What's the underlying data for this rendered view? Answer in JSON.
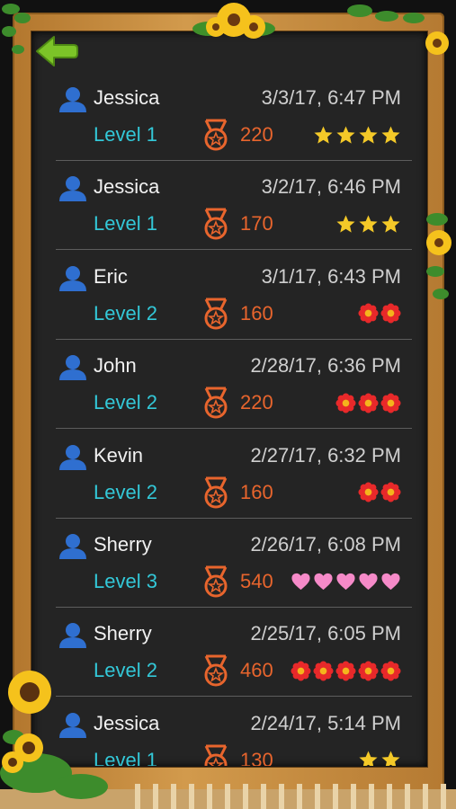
{
  "records": [
    {
      "name": "Jessica",
      "date": "3/3/17, 6:47 PM",
      "level": "Level 1",
      "score": "220",
      "rating_type": "star",
      "rating_count": 4
    },
    {
      "name": "Jessica",
      "date": "3/2/17, 6:46 PM",
      "level": "Level 1",
      "score": "170",
      "rating_type": "star",
      "rating_count": 3
    },
    {
      "name": "Eric",
      "date": "3/1/17, 6:43 PM",
      "level": "Level 2",
      "score": "160",
      "rating_type": "flower",
      "rating_count": 2
    },
    {
      "name": "John",
      "date": "2/28/17, 6:36 PM",
      "level": "Level 2",
      "score": "220",
      "rating_type": "flower",
      "rating_count": 3
    },
    {
      "name": "Kevin",
      "date": "2/27/17, 6:32 PM",
      "level": "Level 2",
      "score": "160",
      "rating_type": "flower",
      "rating_count": 2
    },
    {
      "name": "Sherry",
      "date": "2/26/17, 6:08 PM",
      "level": "Level 3",
      "score": "540",
      "rating_type": "heart",
      "rating_count": 5
    },
    {
      "name": "Sherry",
      "date": "2/25/17, 6:05 PM",
      "level": "Level 2",
      "score": "460",
      "rating_type": "flower",
      "rating_count": 5
    },
    {
      "name": "Jessica",
      "date": "2/24/17, 5:14 PM",
      "level": "Level 1",
      "score": "130",
      "rating_type": "star",
      "rating_count": 2
    }
  ],
  "icons": {
    "back": "back-arrow-icon",
    "user": "user-icon",
    "medal": "medal-icon",
    "star": "star-icon",
    "flower": "flower-icon",
    "heart": "heart-icon"
  },
  "colors": {
    "board": "#242424",
    "name": "#f1f1f1",
    "date": "#cfcfcf",
    "level": "#33c8d8",
    "score": "#e8652d",
    "user_icon": "#2f6fd0",
    "back_arrow": "#7cc428",
    "star": "#f4c928",
    "flower": "#e8292a",
    "heart": "#f58ac8",
    "frame": "#c98c3e"
  }
}
